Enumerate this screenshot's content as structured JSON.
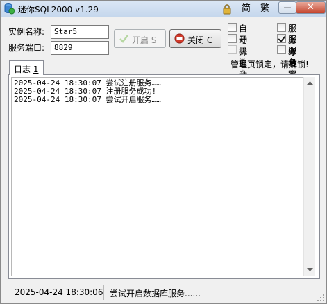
{
  "window": {
    "title": "迷你SQL2000 v1.29",
    "lang_simplified": "简",
    "lang_traditional": "繁",
    "minimize_glyph": "—",
    "close_glyph": "✕"
  },
  "form": {
    "instance_label": "实例名称:",
    "instance_value": "Star5",
    "port_label": "服务端口:",
    "port_value": "8829"
  },
  "buttons": {
    "start_label": "开启",
    "start_key": "S",
    "stop_label": "关闭",
    "stop_key": "C"
  },
  "options": {
    "auto_start": {
      "label": "自动开启",
      "checked": false
    },
    "boot_start": {
      "label": "开机启动",
      "checked": false
    },
    "default_instance": {
      "label": "默认实例",
      "checked": false,
      "disabled": true
    },
    "service_guard": {
      "label": "服务守护",
      "checked": false
    },
    "service_log": {
      "label": "服务日志",
      "checked": true
    },
    "service_window": {
      "label": "服务窗口",
      "checked": false
    }
  },
  "tabs": [
    {
      "label": "日志",
      "key": "1"
    }
  ],
  "notice": "管理页锁定，请解锁!",
  "log_lines": [
    "2025-04-24 18:30:07 尝试注册服务……",
    "2025-04-24 18:30:07 注册服务成功!",
    "2025-04-24 18:30:07 尝试开启服务……"
  ],
  "status": {
    "timestamp": "2025-04-24 18:30:06",
    "message": "尝试开启数据库服务......"
  },
  "colors": {
    "titlebar": "#c4d6ec",
    "close_button": "#c4452e",
    "stop_icon": "#d23a2a",
    "start_icon_disabled": "#b7d7a3"
  },
  "icons": {
    "app": "database-cylinder-icon",
    "lock": "padlock-icon",
    "start": "checkmark-icon",
    "stop": "stop-sign-icon"
  }
}
